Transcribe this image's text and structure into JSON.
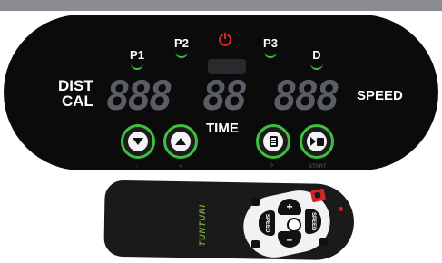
{
  "console": {
    "programs": [
      "P1",
      "P2",
      "P3",
      "D"
    ],
    "dist_label": "DIST",
    "cal_label": "CAL",
    "time_label": "TIME",
    "speed_label": "SPEED",
    "display_1": "888",
    "display_2": "88",
    "display_3": "888",
    "power_glyph": "⏻",
    "buttons": [
      {
        "icon": "chevron-down-icon",
        "label": "-"
      },
      {
        "icon": "chevron-up-icon",
        "label": "+"
      },
      {
        "icon": "program-list-icon",
        "label": "P"
      },
      {
        "icon": "start-stop-icon",
        "label": "START"
      }
    ]
  },
  "remote": {
    "brand": "TUNTURI",
    "top_plus": "+",
    "bottom_minus": "–",
    "left_speed": "SPEED",
    "left_minus": "–",
    "right_speed": "SPEED",
    "right_plus": "+"
  },
  "colors": {
    "accent_green": "#3fbf3f",
    "power_red": "#d42a2a",
    "display_grey": "#5a5d66",
    "console_black": "#0b0b0b"
  }
}
